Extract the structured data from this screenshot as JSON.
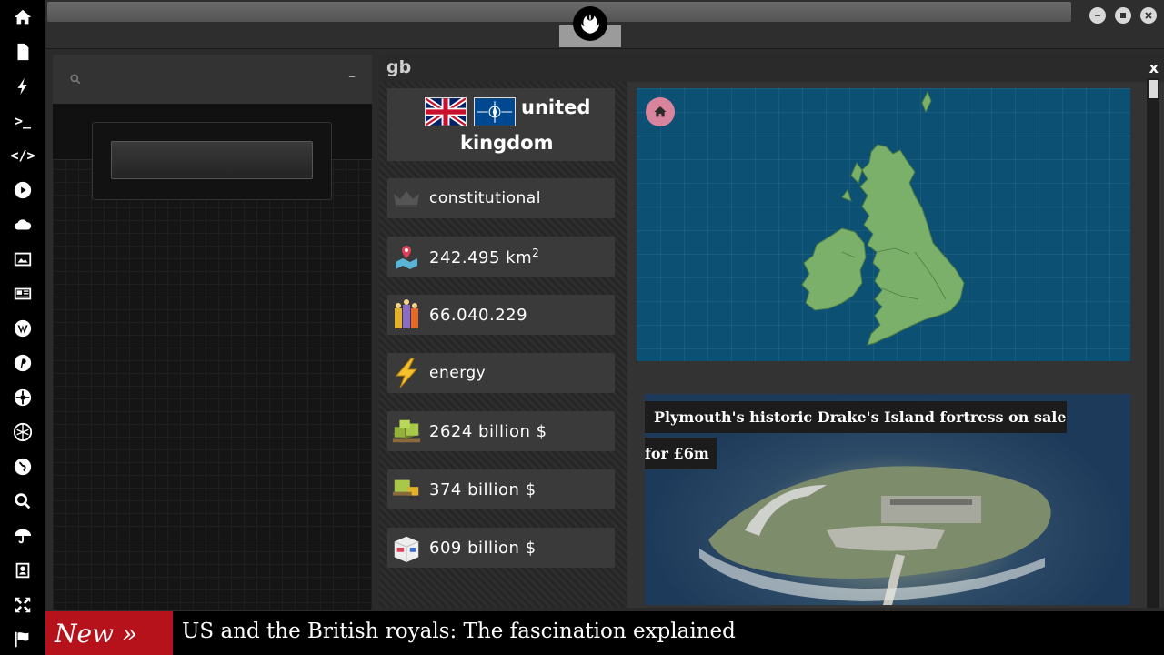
{
  "sidebar": {
    "icons": [
      "home-icon",
      "document-icon",
      "bolt-icon",
      "terminal-icon",
      "code-icon",
      "play-icon",
      "cloud-icon",
      "image-icon",
      "newspaper-icon",
      "wordpress-icon",
      "pinterest-icon",
      "settings-wheel-icon",
      "network-icon",
      "globe-icon",
      "search-icon",
      "umbrella-icon",
      "contacts-icon",
      "expand-icon",
      "flag-icon"
    ],
    "terminal_glyph": ">_",
    "code_glyph": "</>"
  },
  "window": {
    "logo": "rebel-alliance-icon"
  },
  "country_panel": {
    "code": "gb",
    "close_label": "x",
    "name_line1": "united",
    "name_line2": "kingdom",
    "flags": [
      "uk-flag",
      "nato-flag"
    ],
    "government": "constitutional",
    "area_value": "242.495 km",
    "area_unit_sup": "2",
    "population": "66.040.229",
    "energy_label": "energy",
    "gdp": "2624 billion $",
    "exports": "374 billion $",
    "imports": "609 billion $"
  },
  "left_panel": {
    "minimize_label": "–"
  },
  "news": {
    "headline_line1": "Plymouth's historic Drake's Island fortress on sale",
    "headline_line2": "for £6m"
  },
  "ticker": {
    "badge": "New »",
    "text": "US and the British royals: The fascination explained"
  },
  "colors": {
    "accent_red": "#b5121b",
    "map_sea": "#0c5074",
    "map_land": "#7ab06a",
    "home_button": "#d9849d"
  }
}
